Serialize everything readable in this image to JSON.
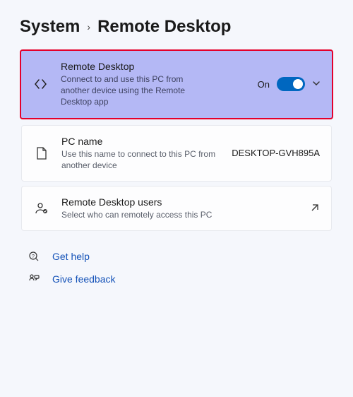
{
  "breadcrumb": {
    "parent": "System",
    "current": "Remote Desktop"
  },
  "mainCard": {
    "title": "Remote Desktop",
    "subtitle": "Connect to and use this PC from another device using the Remote Desktop app",
    "toggleLabel": "On"
  },
  "pcCard": {
    "title": "PC name",
    "subtitle": "Use this name to connect to this PC from another device",
    "value": "DESKTOP-GVH895A"
  },
  "usersCard": {
    "title": "Remote Desktop users",
    "subtitle": "Select who can remotely access this PC"
  },
  "links": {
    "help": "Get help",
    "feedback": "Give feedback"
  }
}
